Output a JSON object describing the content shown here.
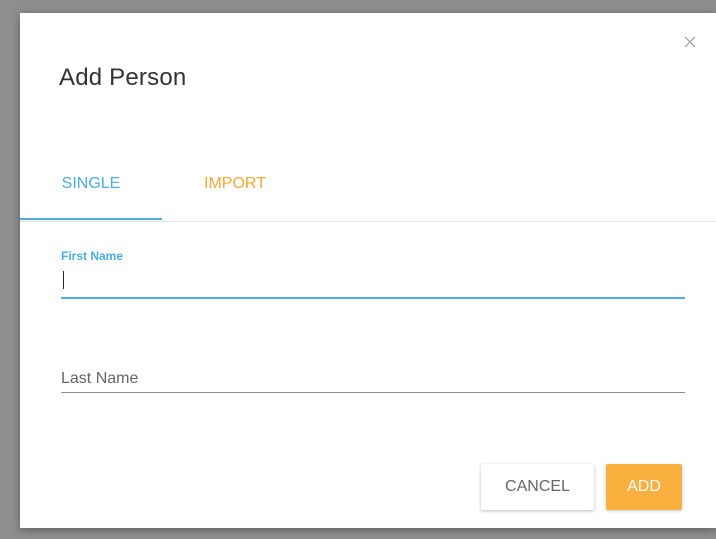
{
  "dialog": {
    "title": "Add Person",
    "close_icon": "close-icon"
  },
  "tabs": [
    {
      "label": "SINGLE",
      "active": true
    },
    {
      "label": "IMPORT",
      "active": false
    }
  ],
  "form": {
    "first_name": {
      "label": "First Name",
      "value": "",
      "focused": true
    },
    "last_name": {
      "placeholder": "Last Name",
      "value": ""
    }
  },
  "actions": {
    "cancel_label": "CANCEL",
    "add_label": "ADD"
  },
  "colors": {
    "accent_blue": "#4aaee0",
    "accent_orange": "#f5a833",
    "add_button": "#f9b03f",
    "backdrop": "#8e8e8e"
  }
}
